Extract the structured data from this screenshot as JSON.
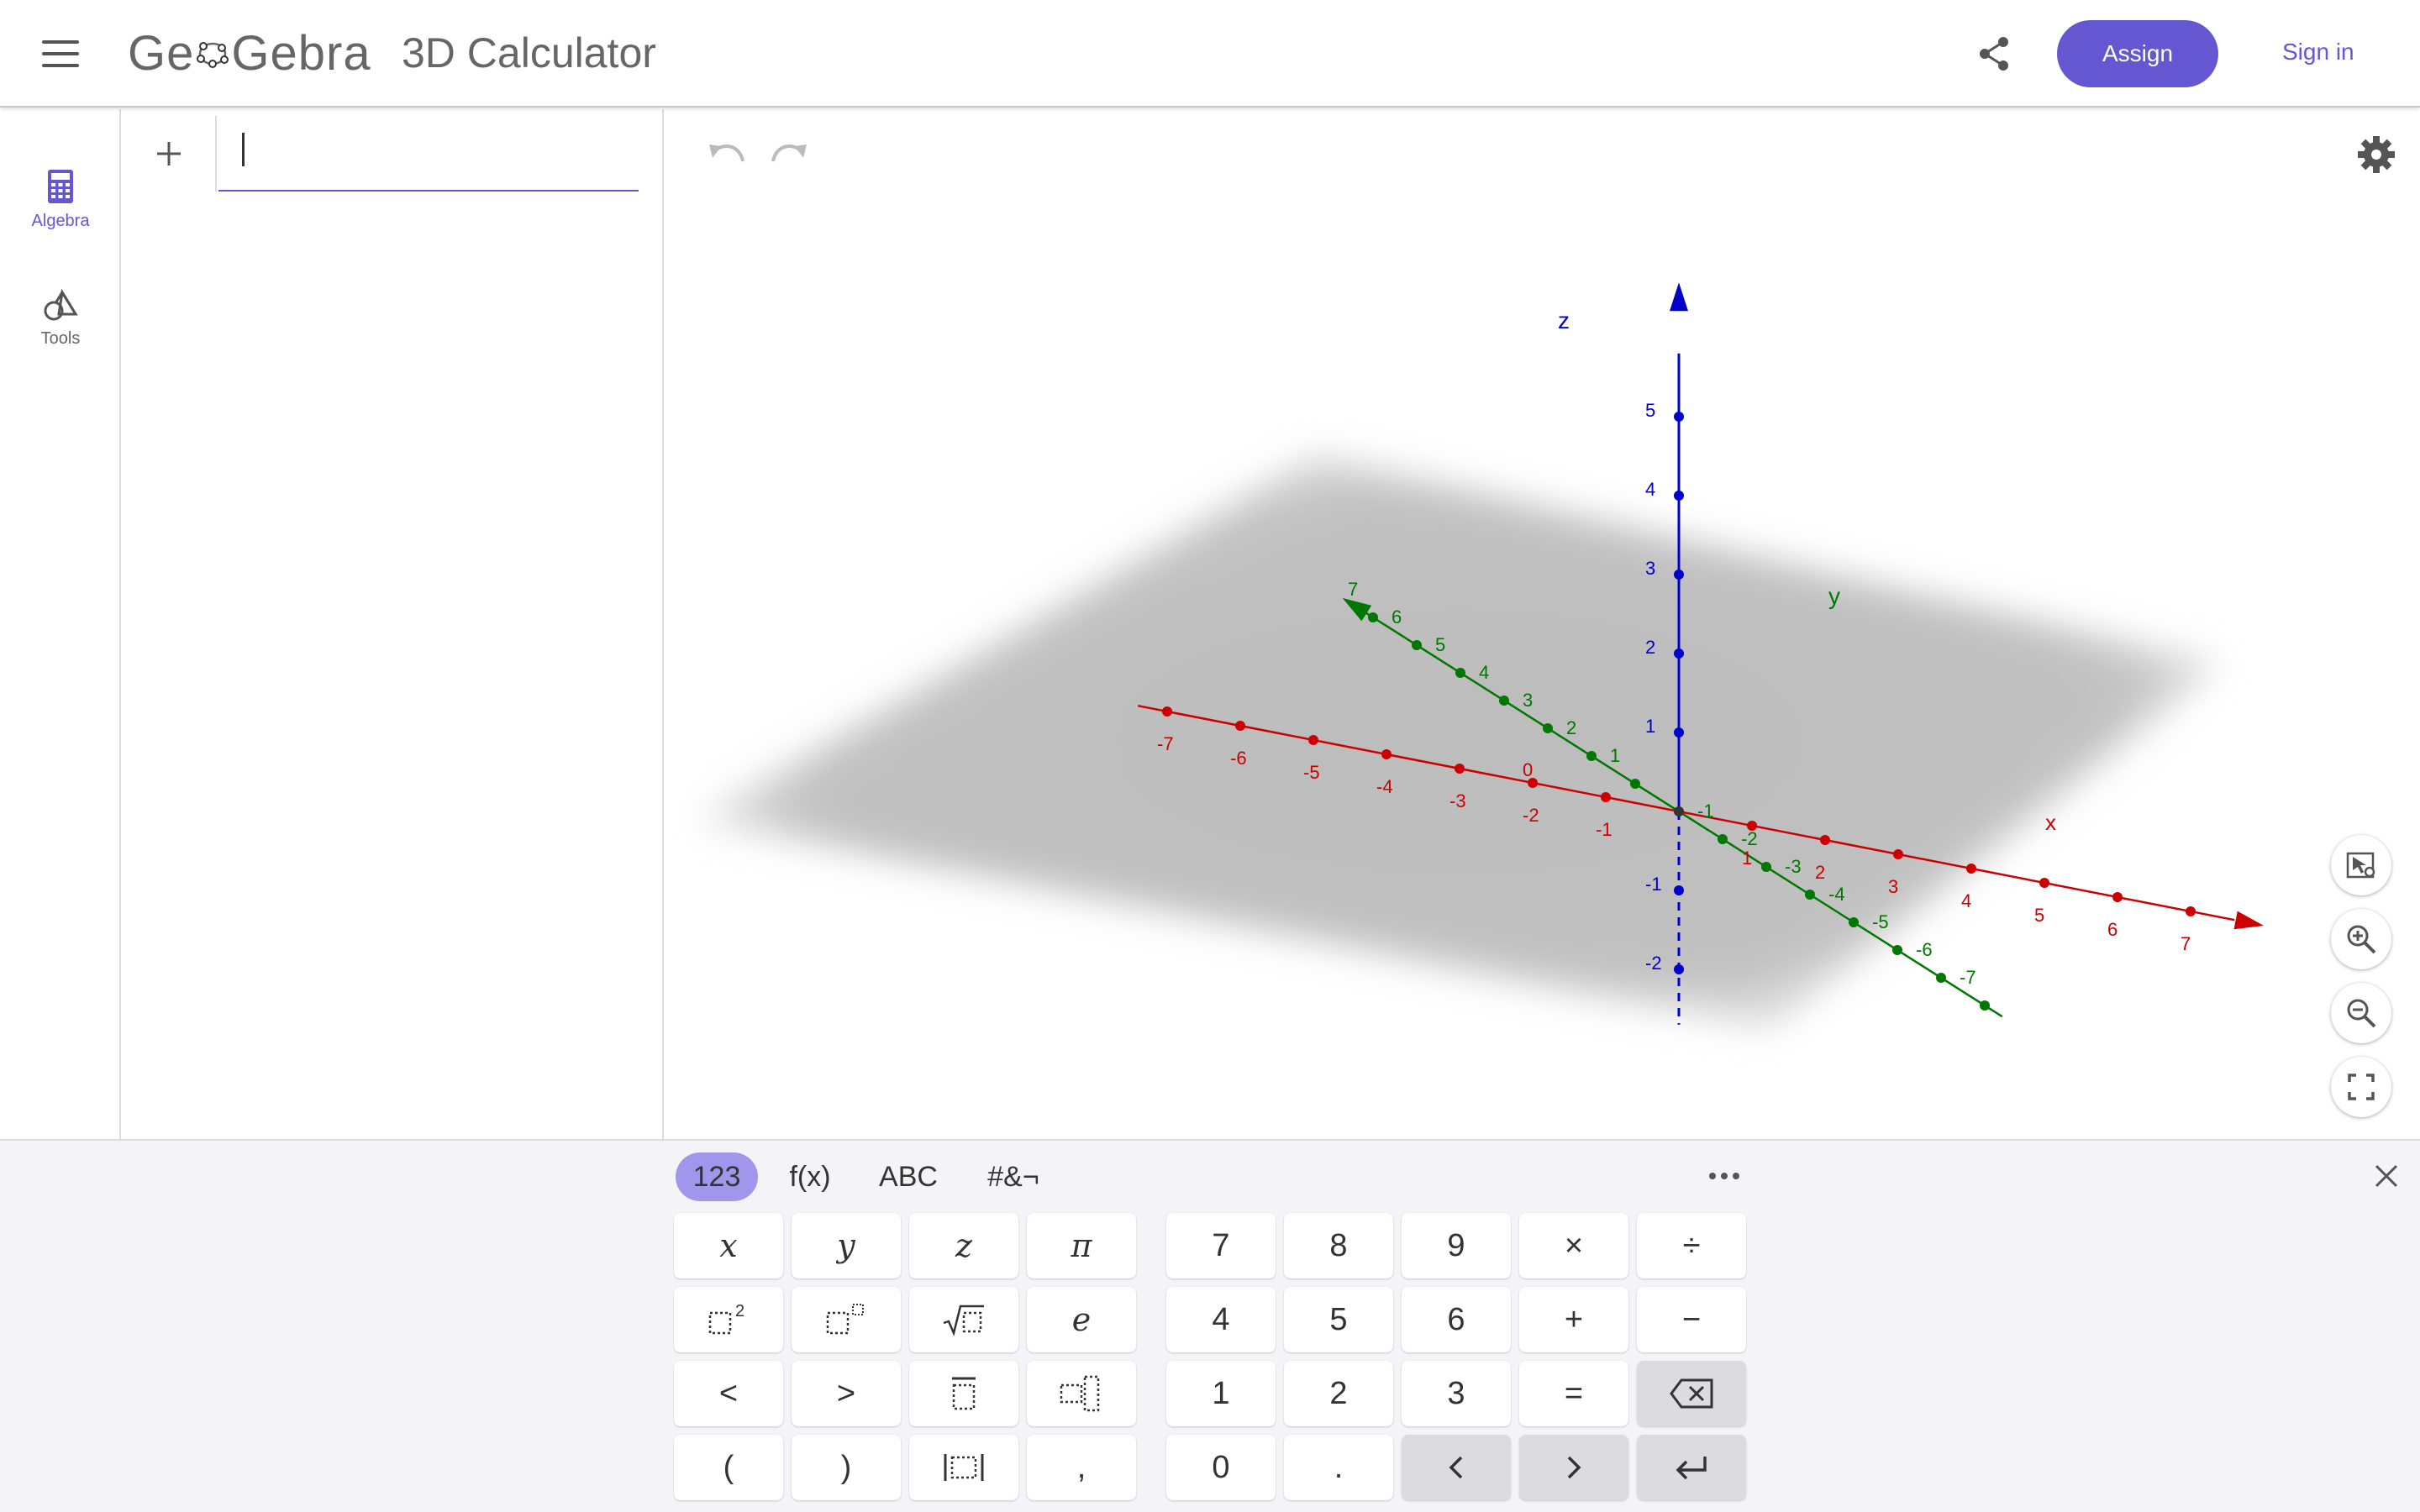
{
  "header": {
    "logo_left": "Ge",
    "logo_right": "Gebra",
    "app_title": "3D Calculator",
    "assign_label": "Assign",
    "signin_label": "Sign in",
    "accent_color": "#6557d2"
  },
  "rail": {
    "algebra_label": "Algebra",
    "tools_label": "Tools"
  },
  "algebra": {
    "input_value": ""
  },
  "graphics": {
    "axis_x_label": "x",
    "axis_y_label": "y",
    "axis_z_label": "z",
    "origin_label": "0",
    "x_ticks": [
      -7,
      -6,
      -5,
      -4,
      -3,
      -2,
      -1,
      1,
      2,
      3,
      4,
      5,
      6,
      7
    ],
    "y_ticks": [
      -7,
      -6,
      -5,
      -4,
      -3,
      -2,
      -1,
      1,
      2,
      3,
      4,
      5,
      6,
      7
    ],
    "z_ticks": [
      -2,
      -1,
      1,
      2,
      3,
      4,
      5
    ],
    "colors": {
      "x_axis": "#cc0000",
      "y_axis": "#007700",
      "z_axis": "#0000cc",
      "plane": "#c8c8c8"
    }
  },
  "keyboard": {
    "tabs": [
      "123",
      "f(x)",
      "ABC",
      "#&¬"
    ],
    "active_tab": "123",
    "left_keys": [
      [
        "x",
        "y",
        "z",
        "π"
      ],
      [
        "□²",
        "□ⁿ",
        "√□",
        "e"
      ],
      [
        "<",
        ">",
        "□̅",
        "□ₙ"
      ],
      [
        "(",
        ")",
        "|□|",
        ","
      ]
    ],
    "right_keys": [
      [
        "7",
        "8",
        "9",
        "×",
        "÷"
      ],
      [
        "4",
        "5",
        "6",
        "+",
        "−"
      ],
      [
        "1",
        "2",
        "3",
        "=",
        "⌫"
      ],
      [
        "0",
        ".",
        "<",
        ">",
        "↵"
      ]
    ]
  }
}
